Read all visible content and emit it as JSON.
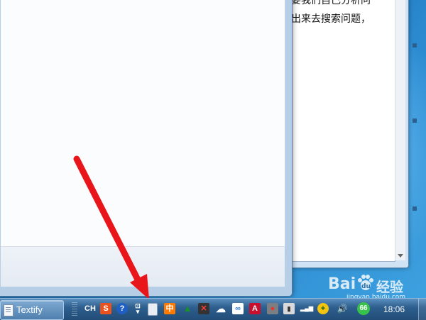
{
  "document": {
    "lines": [
      "要我们自己分析问",
      "出来去搜索问题，"
    ]
  },
  "taskbar": {
    "window_label": "Textify",
    "language": "CH",
    "badge": "66",
    "clock": "18:06",
    "tray_icons": [
      {
        "name": "sogou-input-icon",
        "glyph": "S",
        "color": "#e8521f"
      },
      {
        "name": "help-icon",
        "glyph": "?",
        "color": "#1f5fc4"
      },
      {
        "name": "textify-tray-icon",
        "glyph": "",
        "color": "#e9eef4"
      },
      {
        "name": "chinese-input-icon",
        "glyph": "中",
        "color": "#ff7a00"
      },
      {
        "name": "green-arrow-icon",
        "glyph": "▲",
        "color": "#1a8f2a"
      },
      {
        "name": "blocked-network-icon",
        "glyph": "✕",
        "color": "#cc2020"
      },
      {
        "name": "cloud-icon",
        "glyph": "☁",
        "color": "#ffffff"
      },
      {
        "name": "link-icon",
        "glyph": "∞",
        "color": "#2f7fe0"
      },
      {
        "name": "adobe-icon",
        "glyph": "A",
        "color": "#c8102e"
      },
      {
        "name": "record-icon",
        "glyph": "●",
        "color": "#c0392b"
      },
      {
        "name": "usb-icon",
        "glyph": "▮",
        "color": "#d9d9d9"
      },
      {
        "name": "signal-icon",
        "glyph": "▂▄▆",
        "color": "#ffffff"
      },
      {
        "name": "security-plus-icon",
        "glyph": "+",
        "color": "#f1c40f"
      },
      {
        "name": "volume-icon",
        "glyph": "🔊",
        "color": "#ffffff"
      }
    ]
  },
  "watermark": {
    "brand": "Bai",
    "brand_paw": "du",
    "brand_cn": "经验",
    "url": "jingyan.baidu.com"
  },
  "colors": {
    "arrow": "#e8161b",
    "taskbar": "#2e5f8e"
  }
}
